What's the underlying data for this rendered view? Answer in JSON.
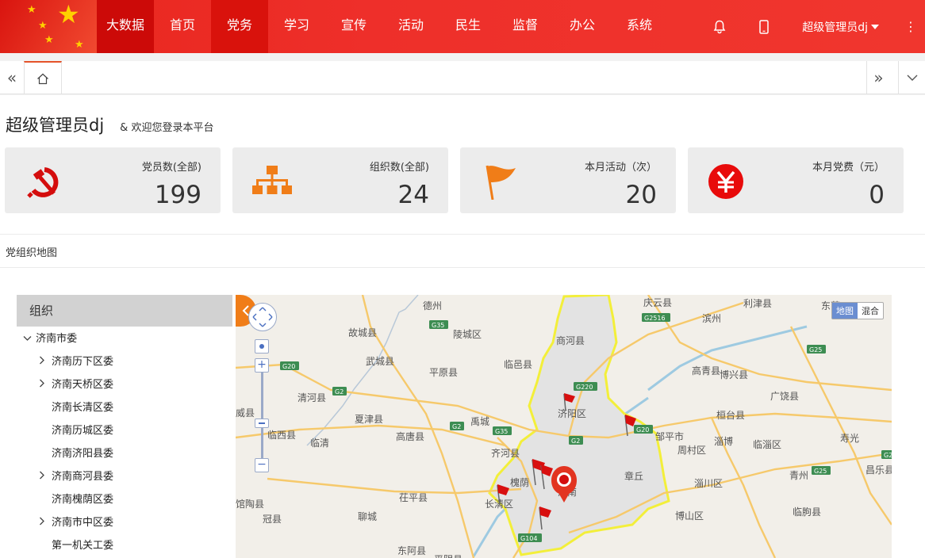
{
  "topnav": {
    "items": [
      "大数据",
      "首页",
      "党务",
      "学习",
      "宣传",
      "活动",
      "民生",
      "监督",
      "办公",
      "系统"
    ],
    "active_index": 0,
    "highlight_index": 2
  },
  "user": {
    "name": "超级管理员dj"
  },
  "welcome": {
    "name": "超级管理员dj",
    "message": "& 欢迎您登录本平台"
  },
  "stats": [
    {
      "label": "党员数(全部)",
      "value": "199",
      "icon": "hammer-sickle-icon"
    },
    {
      "label": "组织数(全部)",
      "value": "24",
      "icon": "org-chart-icon"
    },
    {
      "label": "本月活动（次）",
      "value": "20",
      "icon": "flag-icon"
    },
    {
      "label": "本月党费（元）",
      "value": "0",
      "icon": "yuan-icon"
    }
  ],
  "section": {
    "title": "党组织地图"
  },
  "tree": {
    "header": "组织",
    "root": "济南市委",
    "children": [
      {
        "label": "济南历下区委",
        "expandable": true
      },
      {
        "label": "济南天桥区委",
        "expandable": true
      },
      {
        "label": "济南长清区委",
        "expandable": false
      },
      {
        "label": "济南历城区委",
        "expandable": false
      },
      {
        "label": "济南济阳县委",
        "expandable": false
      },
      {
        "label": "济南商河县委",
        "expandable": true
      },
      {
        "label": "济南槐荫区委",
        "expandable": false
      },
      {
        "label": "济南市中区委",
        "expandable": true
      },
      {
        "label": "第一机关工委",
        "expandable": false
      }
    ]
  },
  "map": {
    "type_buttons": [
      "地图",
      "混合"
    ],
    "active_type": "地图",
    "labels": [
      {
        "text": "德州"
      },
      {
        "text": "庆云县"
      },
      {
        "text": "利津县"
      },
      {
        "text": "东营"
      },
      {
        "text": "故城县"
      },
      {
        "text": "陵城区"
      },
      {
        "text": "商河县"
      },
      {
        "text": "滨州"
      },
      {
        "text": "武城县"
      },
      {
        "text": "临邑县"
      },
      {
        "text": "平原县"
      },
      {
        "text": "高青县"
      },
      {
        "text": "博兴县"
      },
      {
        "text": "清河县"
      },
      {
        "text": "夏津县"
      },
      {
        "text": "济阳区"
      },
      {
        "text": "广饶县"
      },
      {
        "text": "禹城"
      },
      {
        "text": "桓台县"
      },
      {
        "text": "临西县"
      },
      {
        "text": "临清"
      },
      {
        "text": "高唐县"
      },
      {
        "text": "齐河县"
      },
      {
        "text": "邹平市"
      },
      {
        "text": "周村区"
      },
      {
        "text": "淄博"
      },
      {
        "text": "临淄区"
      },
      {
        "text": "寿光"
      },
      {
        "text": "章丘"
      },
      {
        "text": "青州"
      },
      {
        "text": "昌乐县"
      },
      {
        "text": "威县"
      },
      {
        "text": "槐荫"
      },
      {
        "text": "济南"
      },
      {
        "text": "淄川区"
      },
      {
        "text": "长清区"
      },
      {
        "text": "茌平县"
      },
      {
        "text": "馆陶县"
      },
      {
        "text": "冠县"
      },
      {
        "text": "聊城"
      },
      {
        "text": "博山区"
      },
      {
        "text": "临朐县"
      },
      {
        "text": "东阿县"
      },
      {
        "text": "平阴县"
      }
    ],
    "roads": [
      "G35",
      "G2516",
      "G20",
      "G2",
      "G25",
      "G220",
      "G104",
      "G20",
      "G35",
      "G2",
      "G2",
      "G20",
      "G25"
    ]
  }
}
